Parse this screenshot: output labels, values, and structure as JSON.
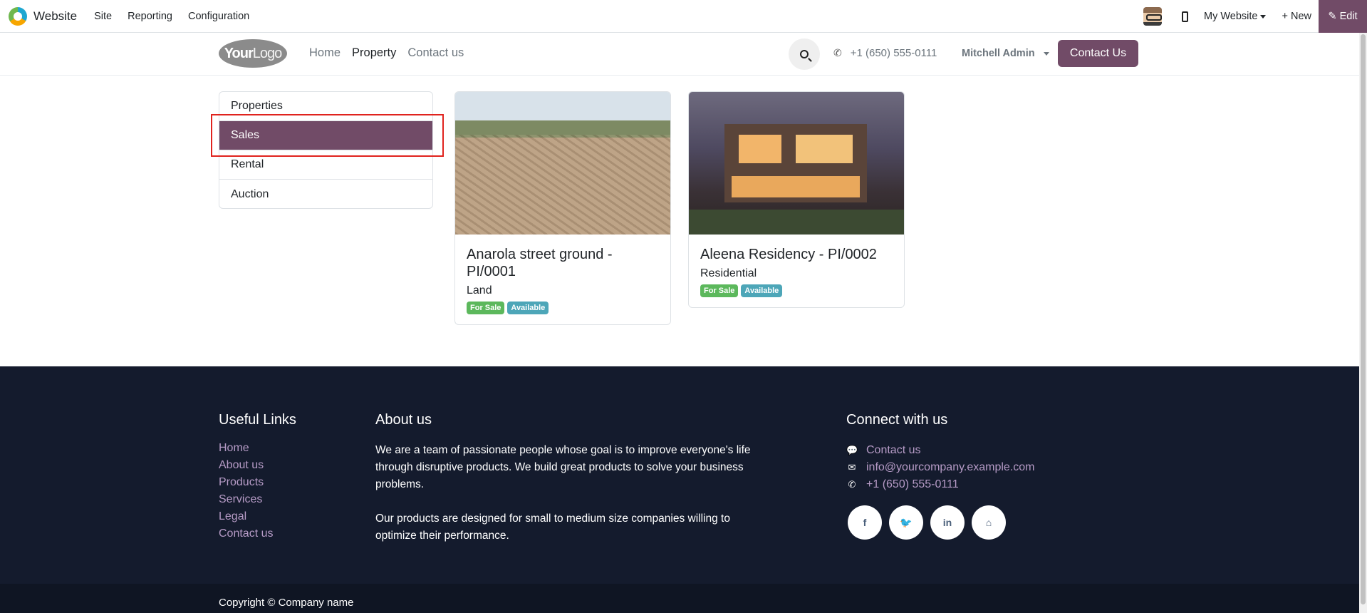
{
  "adminbar": {
    "app_name": "Website",
    "menu": [
      "Site",
      "Reporting",
      "Configuration"
    ],
    "my_website": "My Website",
    "new_label": "+ New",
    "edit_label": "✎ Edit"
  },
  "header": {
    "logo_bold": "Your",
    "logo_light": "Logo",
    "nav": [
      "Home",
      "Property",
      "Contact us"
    ],
    "phone": "+1 (650) 555-0111",
    "user": "Mitchell Admin",
    "cta": "Contact Us"
  },
  "sidebar": {
    "items": [
      "Properties",
      "Sales",
      "Rental",
      "Auction"
    ],
    "active_index": 1
  },
  "cards": [
    {
      "title": "Anarola street ground - PI/0001",
      "type": "Land",
      "badges": [
        "For Sale",
        "Available"
      ]
    },
    {
      "title": "Aleena Residency - PI/0002",
      "type": "Residential",
      "badges": [
        "For Sale",
        "Available"
      ]
    }
  ],
  "footer": {
    "useful_links_title": "Useful Links",
    "useful_links": [
      "Home",
      "About us",
      "Products",
      "Services",
      "Legal",
      "Contact us"
    ],
    "about_title": "About us",
    "about_p1": "We are a team of passionate people whose goal is to improve everyone's life through disruptive products. We build great products to solve your business problems.",
    "about_p2": "Our products are designed for small to medium size companies willing to optimize their performance.",
    "connect_title": "Connect with us",
    "connect": [
      "Contact us",
      "info@yourcompany.example.com",
      "+1 (650) 555-0111"
    ],
    "copyright": "Copyright © Company name"
  },
  "colors": {
    "brand": "#714b67",
    "footer_bg": "#141b2d",
    "link": "#b69bc6",
    "badge_green": "#5cb85c",
    "badge_blue": "#4da6b8",
    "highlight": "#e0231e"
  },
  "icons": [
    "search-icon",
    "phone-icon",
    "chevron-down-icon",
    "comment-icon",
    "envelope-icon",
    "facebook-icon",
    "twitter-icon",
    "linkedin-icon",
    "home-icon"
  ]
}
